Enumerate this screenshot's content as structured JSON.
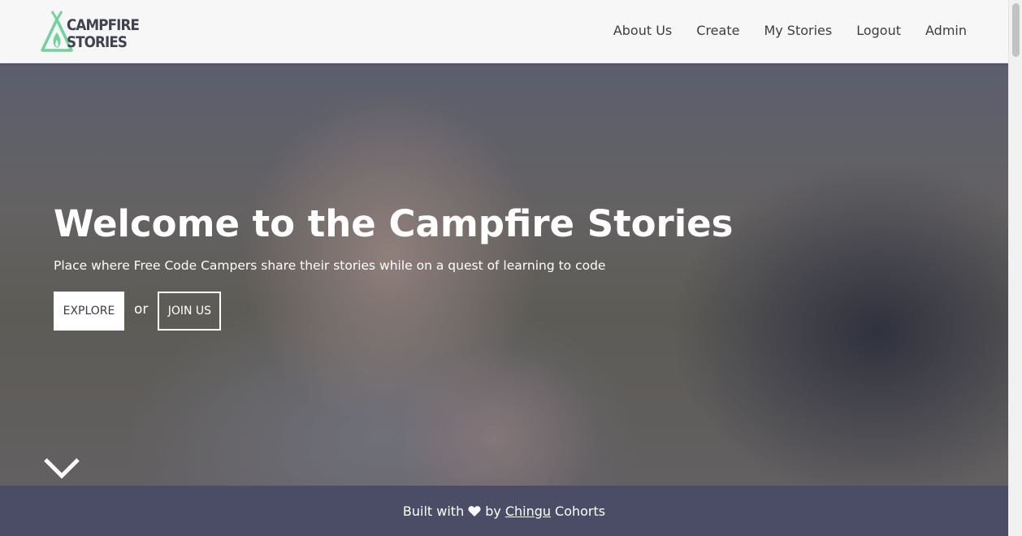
{
  "brand": {
    "line1": "CAMPFIRE",
    "line2": "STORIES",
    "logo_icon": "teepee-flame-icon",
    "accent_color": "#6fd39a"
  },
  "nav": {
    "items": [
      {
        "label": "About Us"
      },
      {
        "label": "Create"
      },
      {
        "label": "My Stories"
      },
      {
        "label": "Logout"
      },
      {
        "label": "Admin"
      }
    ]
  },
  "hero": {
    "title": "Welcome to the Campfire Stories",
    "subtitle": "Place where Free Code Campers share their stories while on a quest of learning to code",
    "explore_label": "EXPLORE",
    "or_text": "or",
    "join_label": "JOIN US",
    "scroll_icon": "chevron-down-icon"
  },
  "footer": {
    "prefix": "Built with",
    "heart_icon": "heart-icon",
    "by": "by",
    "link": "Chingu",
    "suffix": "Cohorts",
    "background": "#4b4d66"
  }
}
